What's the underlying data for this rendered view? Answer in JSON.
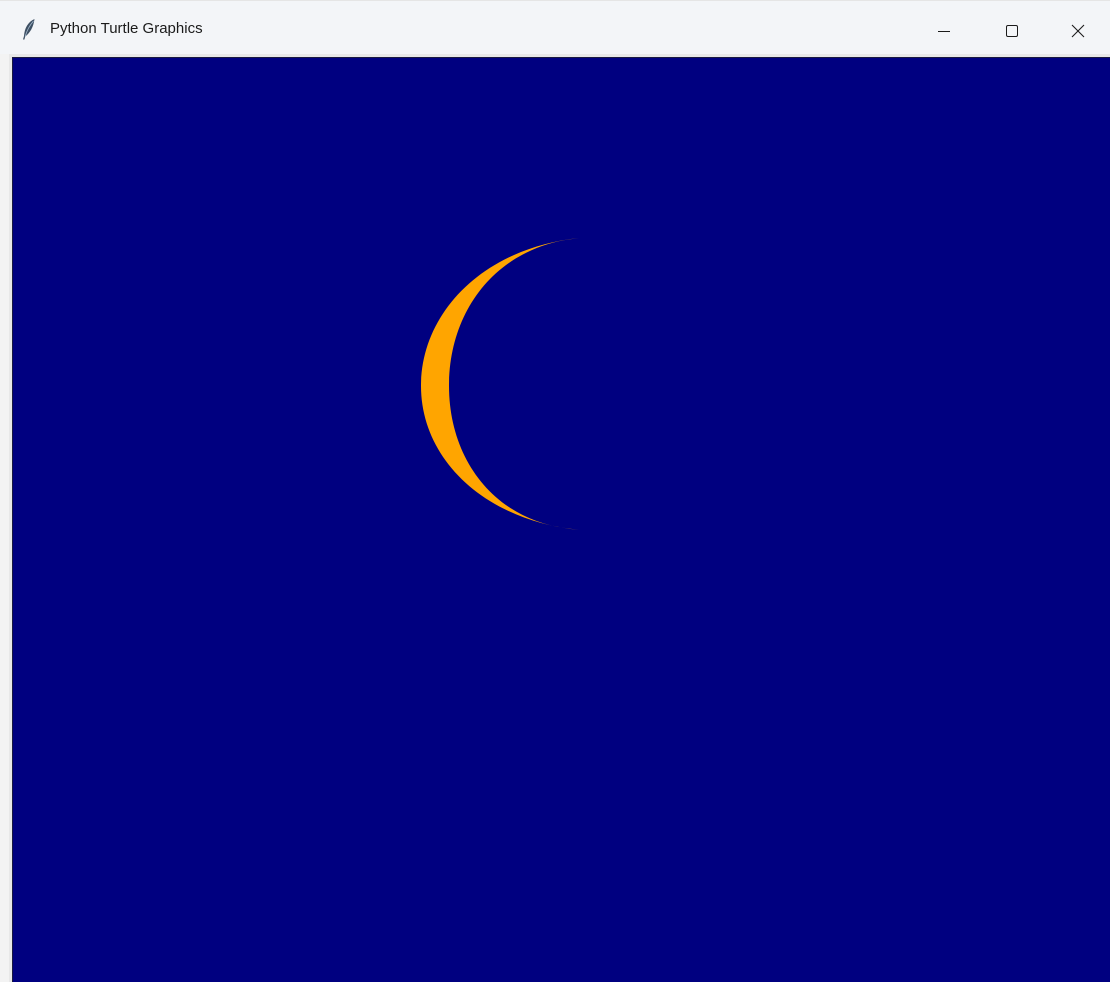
{
  "window": {
    "title": "Python Turtle Graphics",
    "icon": "feather-icon",
    "controls": {
      "minimize": "minimize-icon",
      "maximize": "maximize-icon",
      "close": "close-icon"
    }
  },
  "canvas": {
    "background_color": "#000080",
    "shape": {
      "kind": "crescent-moon",
      "color": "#FFA500"
    }
  }
}
